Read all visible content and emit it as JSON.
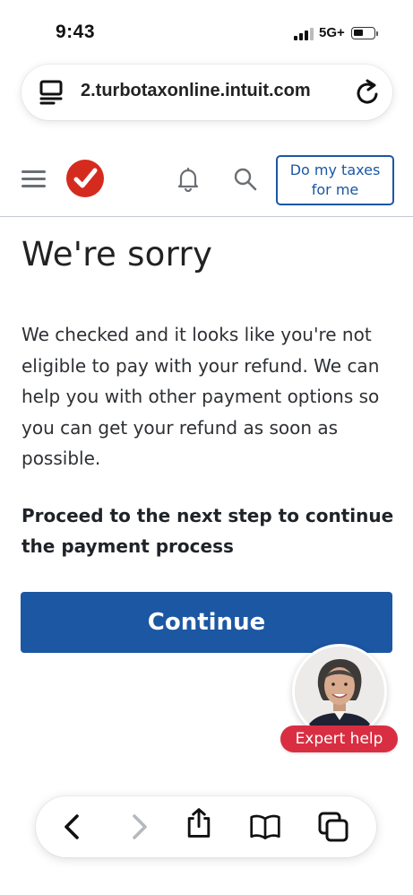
{
  "status_bar": {
    "time": "9:43",
    "network": "5G+"
  },
  "browser": {
    "url": "2.turbotaxonline.intuit.com",
    "icons": [
      "tab-layout-icon",
      "reload-icon"
    ]
  },
  "header": {
    "cta_label_line1": "Do my taxes",
    "cta_label_line2": "for me",
    "icons": [
      "hamburger-menu-icon",
      "turbotax-logo",
      "bell-icon",
      "search-icon"
    ]
  },
  "main": {
    "title": "We're sorry",
    "body": "We checked and it looks like you're not eligible to pay with your refund. We can help you with other payment options so you can get your refund as soon as possible.",
    "instruction": "Proceed to the next step to continue the payment process",
    "continue_label": "Continue"
  },
  "expert_help": {
    "label": "Expert help"
  },
  "toolbar": {
    "icons": [
      "back-icon",
      "forward-icon",
      "share-icon",
      "bookmarks-icon",
      "tabs-icon"
    ]
  },
  "colors": {
    "brand_blue": "#1c57a3",
    "brand_red": "#d52b1e",
    "expert_badge": "#d92e42"
  }
}
